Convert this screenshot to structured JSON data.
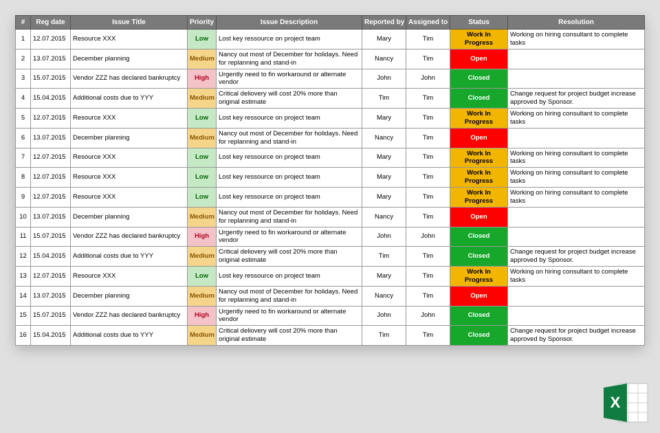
{
  "headers": {
    "num": "#",
    "reg_date": "Reg date",
    "title": "Issue Title",
    "priority": "Priority",
    "description": "Issue Description",
    "reported_by": "Reported by",
    "assigned_to": "Assigned to",
    "status": "Status",
    "resolution": "Resolution"
  },
  "priority_labels": {
    "low": "Low",
    "medium": "Medium",
    "high": "High"
  },
  "status_labels": {
    "wip": "Work In Progress",
    "open": "Open",
    "closed": "Closed"
  },
  "rows": [
    {
      "num": "1",
      "date": "12.07.2015",
      "title": "Resource XXX",
      "priority": "low",
      "desc": "Lost key ressource on project team",
      "reported": "Mary",
      "assigned": "Tim",
      "status": "wip",
      "resolution": "Working on hiring consultant to complete tasks"
    },
    {
      "num": "2",
      "date": "13.07.2015",
      "title": "December planning",
      "priority": "medium",
      "desc": "Nancy out most of December for holidays. Need for replanning and stand-in",
      "reported": "Nancy",
      "assigned": "Tim",
      "status": "open",
      "resolution": ""
    },
    {
      "num": "3",
      "date": "15.07.2015",
      "title": "Vendor ZZZ has declared bankruptcy",
      "priority": "high",
      "desc": "Urgently need to fin workaround or alternate vendor",
      "reported": "John",
      "assigned": "John",
      "status": "closed",
      "resolution": ""
    },
    {
      "num": "4",
      "date": "15.04.2015",
      "title": "Additional costs due to YYY",
      "priority": "medium",
      "desc": "Critical deliovery will cost 20% more than original estimate",
      "reported": "Tim",
      "assigned": "Tim",
      "status": "closed",
      "resolution": "Change request for project budget increase approved by Sponsor."
    },
    {
      "num": "5",
      "date": "12.07.2015",
      "title": "Resource XXX",
      "priority": "low",
      "desc": "Lost key ressource on project team",
      "reported": "Mary",
      "assigned": "Tim",
      "status": "wip",
      "resolution": "Working on hiring consultant to complete tasks"
    },
    {
      "num": "6",
      "date": "13.07.2015",
      "title": "December planning",
      "priority": "medium",
      "desc": "Nancy out most of December for holidays. Need for replanning and stand-in",
      "reported": "Nancy",
      "assigned": "Tim",
      "status": "open",
      "resolution": ""
    },
    {
      "num": "7",
      "date": "12.07.2015",
      "title": "Resource XXX",
      "priority": "low",
      "desc": "Lost key ressource on project team",
      "reported": "Mary",
      "assigned": "Tim",
      "status": "wip",
      "resolution": "Working on hiring consultant to complete tasks"
    },
    {
      "num": "8",
      "date": "12.07.2015",
      "title": "Resource XXX",
      "priority": "low",
      "desc": "Lost key ressource on project team",
      "reported": "Mary",
      "assigned": "Tim",
      "status": "wip",
      "resolution": "Working on hiring consultant to complete tasks"
    },
    {
      "num": "9",
      "date": "12.07.2015",
      "title": "Resource XXX",
      "priority": "low",
      "desc": "Lost key ressource on project team",
      "reported": "Mary",
      "assigned": "Tim",
      "status": "wip",
      "resolution": "Working on hiring consultant to complete tasks"
    },
    {
      "num": "10",
      "date": "13.07.2015",
      "title": "December planning",
      "priority": "medium",
      "desc": "Nancy out most of December for holidays. Need for replanning and stand-in",
      "reported": "Nancy",
      "assigned": "Tim",
      "status": "open",
      "resolution": ""
    },
    {
      "num": "11",
      "date": "15.07.2015",
      "title": "Vendor ZZZ has declared bankruptcy",
      "priority": "high",
      "desc": "Urgently need to fin workaround or alternate vendor",
      "reported": "John",
      "assigned": "John",
      "status": "closed",
      "resolution": ""
    },
    {
      "num": "12",
      "date": "15.04.2015",
      "title": "Additional costs due to YYY",
      "priority": "medium",
      "desc": "Critical deliovery will cost 20% more than original estimate",
      "reported": "Tim",
      "assigned": "Tim",
      "status": "closed",
      "resolution": "Change request for project budget increase approved by Sponsor."
    },
    {
      "num": "13",
      "date": "12.07.2015",
      "title": "Resource XXX",
      "priority": "low",
      "desc": "Lost key ressource on project team",
      "reported": "Mary",
      "assigned": "Tim",
      "status": "wip",
      "resolution": "Working on hiring consultant to complete tasks"
    },
    {
      "num": "14",
      "date": "13.07.2015",
      "title": "December planning",
      "priority": "medium",
      "desc": "Nancy out most of December for holidays. Need for replanning and stand-in",
      "reported": "Nancy",
      "assigned": "Tim",
      "status": "open",
      "resolution": ""
    },
    {
      "num": "15",
      "date": "15.07.2015",
      "title": "Vendor ZZZ has declared bankruptcy",
      "priority": "high",
      "desc": "Urgently need to fin workaround or alternate vendor",
      "reported": "John",
      "assigned": "John",
      "status": "closed",
      "resolution": ""
    },
    {
      "num": "16",
      "date": "15.04.2015",
      "title": "Additional costs due to YYY",
      "priority": "medium",
      "desc": "Critical deliovery will cost 20% more than original estimate",
      "reported": "Tim",
      "assigned": "Tim",
      "status": "closed",
      "resolution": "Change request for project budget increase approved by Sponsor."
    }
  ]
}
